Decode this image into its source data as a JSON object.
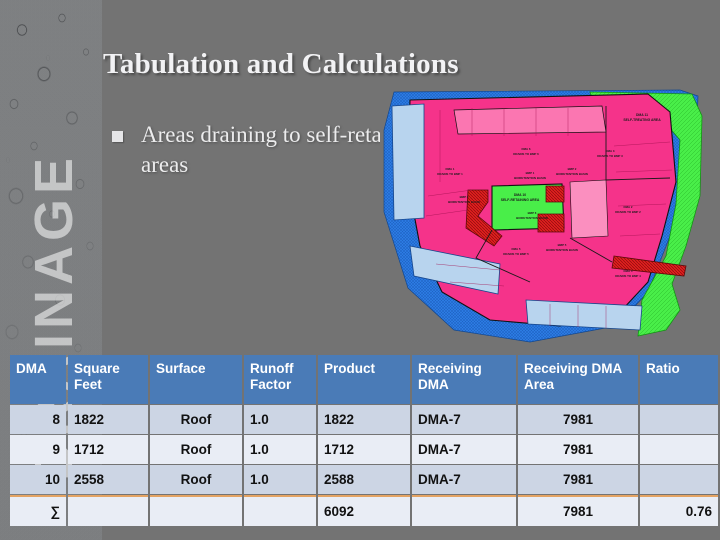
{
  "slide": {
    "title": "Tabulation and Calculations",
    "background_color": "#737373",
    "bullets": [
      {
        "marker": "square-bullet",
        "text": "Areas draining to self-retaining areas"
      }
    ],
    "side_watermark": "DRAINAGE"
  },
  "map": {
    "alt_name": "site-drainage-management-area-map",
    "legend_colors": {
      "self_treating_area": "#49ee49",
      "self_retaining_area": "#49ee49",
      "drains_to_bmp": "#f5338a",
      "bmp_basin": "#e01f1f",
      "pervious_offsite": "#2f7fe8",
      "sidewalk_parcel": "#b8d4ee"
    },
    "labels": [
      {
        "id": "dma-11",
        "line1": "DMA 11",
        "line2": "SELF-TREATING AREA"
      },
      {
        "id": "dma-10",
        "line1": "DMA 10",
        "line2": "SELF-RETAINING AREA"
      },
      {
        "id": "dma-1",
        "line1": "DMA 1",
        "line2": "DRAINS TO BMP 1"
      },
      {
        "id": "dma-2",
        "line1": "DMA 2",
        "line2": "DRAINS TO BMP 2"
      },
      {
        "id": "dma-3",
        "line1": "DMA 3",
        "line2": "DRAINS TO BMP 3"
      },
      {
        "id": "dma-4",
        "line1": "DMA 4",
        "line2": "DRAINS TO BMP 4"
      },
      {
        "id": "dma-5",
        "line1": "DMA 5",
        "line2": "DRAINS TO BMP 5"
      },
      {
        "id": "dma-6",
        "line1": "DMA 6",
        "line2": "DRAINS TO BMP 6"
      },
      {
        "id": "bmp-1",
        "line1": "BMP 1",
        "line2": "BIORETENTION BASIN"
      },
      {
        "id": "bmp-2",
        "line1": "BMP 2",
        "line2": "BIORETENTION BASIN"
      },
      {
        "id": "bmp-3",
        "line1": "BMP 3",
        "line2": "BIORETENTION BASIN"
      },
      {
        "id": "bmp-5",
        "line1": "BMP 5",
        "line2": "BIORETENTION BASIN"
      },
      {
        "id": "bmp-6",
        "line1": "BMP 6",
        "line2": "BIORETENTION BASIN"
      }
    ]
  },
  "table": {
    "accent_header_color": "#4a7bb7",
    "sum_divider_color": "#e4a362",
    "columns": [
      {
        "key": "dma",
        "label": "DMA"
      },
      {
        "key": "sqft",
        "label": "Square Feet"
      },
      {
        "key": "surf",
        "label": "Surface"
      },
      {
        "key": "rf",
        "label": "Runoff Factor"
      },
      {
        "key": "prod",
        "label": "Product"
      },
      {
        "key": "rdma",
        "label": "Receiving DMA"
      },
      {
        "key": "rarea",
        "label": "Receiving DMA Area"
      },
      {
        "key": "ratio",
        "label": "Ratio"
      }
    ],
    "rows": [
      {
        "dma": "8",
        "sqft": "1822",
        "surf": "Roof",
        "rf": "1.0",
        "prod": "1822",
        "rdma": "DMA-7",
        "rarea": "7981",
        "ratio": ""
      },
      {
        "dma": "9",
        "sqft": "1712",
        "surf": "Roof",
        "rf": "1.0",
        "prod": "1712",
        "rdma": "DMA-7",
        "rarea": "7981",
        "ratio": ""
      },
      {
        "dma": "10",
        "sqft": "2558",
        "surf": "Roof",
        "rf": "1.0",
        "prod": "2588",
        "rdma": "DMA-7",
        "rarea": "7981",
        "ratio": ""
      }
    ],
    "sum_row": {
      "dma": "∑",
      "sqft": "",
      "surf": "",
      "rf": "",
      "prod": "6092",
      "rdma": "",
      "rarea": "7981",
      "ratio": "0.76"
    }
  }
}
